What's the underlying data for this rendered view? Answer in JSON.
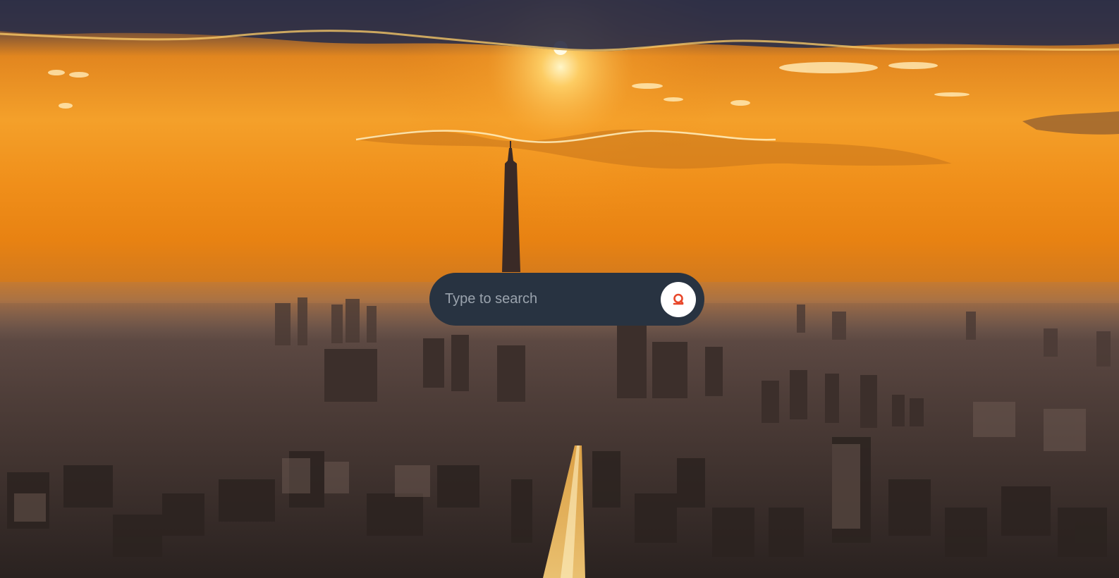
{
  "search": {
    "placeholder": "Type to search",
    "value": "",
    "button_icon": "search-icon",
    "accent_color": "#e8472a",
    "box_color": "#283341"
  },
  "background": {
    "description_icon": "city-skyline-sunset-image"
  }
}
